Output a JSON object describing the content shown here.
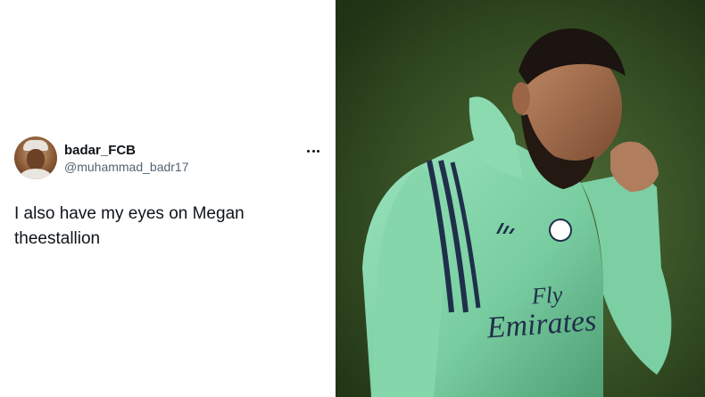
{
  "tweet": {
    "display_name": "badar_FCB",
    "handle": "@muhammad_badr17",
    "text_line_1": "I also have my eyes on Megan",
    "text_line_2": "theestallion",
    "more_icon": "more-horizontal-icon"
  },
  "photo": {
    "jersey_text": "Fly Emirates",
    "brand": "adidas"
  },
  "colors": {
    "text_primary": "#0f1419",
    "text_secondary": "#536471",
    "grass": "#3a5427",
    "jacket": "#7fd1a6"
  }
}
